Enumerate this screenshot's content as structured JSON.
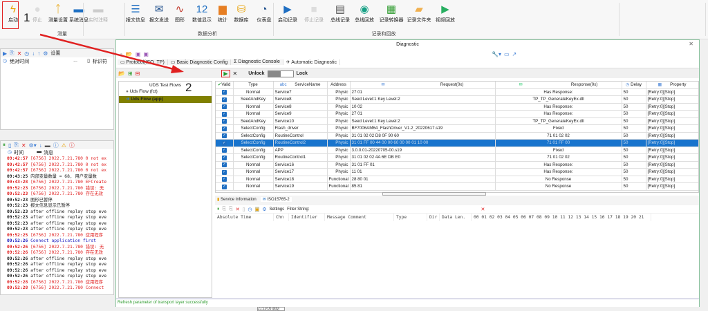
{
  "ribbon": {
    "buttons": [
      {
        "label": "启动",
        "icon": "lightning-icon",
        "disabled": false
      },
      {
        "label": "停止",
        "icon": "stop-circle-icon",
        "disabled": true
      },
      {
        "label": "测量设置",
        "icon": "measurement-setup-icon",
        "disabled": false
      },
      {
        "label": "系统消息",
        "icon": "chat-icon",
        "disabled": false
      },
      {
        "label": "实时注释",
        "icon": "comment-icon",
        "disabled": true
      },
      {
        "label": "报文信息",
        "icon": "list-icon",
        "disabled": false
      },
      {
        "label": "报文发送",
        "icon": "mail-send-icon",
        "disabled": false
      },
      {
        "label": "图形",
        "icon": "line-chart-icon",
        "disabled": false
      },
      {
        "label": "数值显示",
        "icon": "number-icon",
        "disabled": false
      },
      {
        "label": "统计",
        "icon": "bar-chart-icon",
        "disabled": false
      },
      {
        "label": "数据库",
        "icon": "database-icon",
        "disabled": false
      },
      {
        "label": "仪表盘",
        "icon": "gauge-icon",
        "disabled": false
      },
      {
        "label": "启动记录",
        "icon": "play-icon",
        "disabled": false
      },
      {
        "label": "停止记录",
        "icon": "stop-icon",
        "disabled": true
      },
      {
        "label": "总线记录",
        "icon": "bus-record-icon",
        "disabled": false
      },
      {
        "label": "总线回放",
        "icon": "bus-replay-icon",
        "disabled": false
      },
      {
        "label": "记录转换器",
        "icon": "converter-icon",
        "disabled": false
      },
      {
        "label": "记录文件夹",
        "icon": "folder-icon",
        "disabled": false
      },
      {
        "label": "视频回放",
        "icon": "video-play-icon",
        "disabled": false
      }
    ],
    "groups": [
      "测量",
      "数据分析",
      "记录和回放"
    ]
  },
  "annotations": {
    "step1": "1",
    "step2": "2",
    "accent": "#e02020"
  },
  "left_top": {
    "settings_label": "设置",
    "columns": [
      "绝对时间",
      "...",
      "标识符"
    ]
  },
  "left_log": {
    "columns": [
      "时间",
      "消息"
    ],
    "rows": [
      {
        "t": "09:42:57",
        "m": "[6756] 2022.7.21.780 0 not ex",
        "c": "red"
      },
      {
        "t": "09:42:57",
        "m": "[6756] 2022.7.21.780 0 not ex",
        "c": "red"
      },
      {
        "t": "09:42:57",
        "m": "[6756] 2022.7.21.780 0 not ex",
        "c": "red"
      },
      {
        "t": "09:43:25",
        "m": "内部变量数量 = 68, 用户变量数",
        "c": ""
      },
      {
        "t": "09:43:28",
        "m": "[6756] 2022.7.21.780 EFCreate",
        "c": "red"
      },
      {
        "t": "09:52:23",
        "m": "[6756] 2022.7.21.780 错误: 无",
        "c": "red"
      },
      {
        "t": "09:52:23",
        "m": "[6756] 2022.7.21.780 存在无效",
        "c": "red"
      },
      {
        "t": "09:52:23",
        "m": "图形已暂停",
        "c": ""
      },
      {
        "t": "09:52:23",
        "m": "报文信息显示已暂停",
        "c": ""
      },
      {
        "t": "09:52:23",
        "m": "after offline replay stop eve",
        "c": ""
      },
      {
        "t": "09:52:23",
        "m": "after offline replay stop eve",
        "c": ""
      },
      {
        "t": "09:52:23",
        "m": "after offline replay stop eve",
        "c": ""
      },
      {
        "t": "09:52:23",
        "m": "after offline replay stop eve",
        "c": ""
      },
      {
        "t": "09:52:25",
        "m": "[6756] 2022.7.21.780 应用程序",
        "c": "red"
      },
      {
        "t": "09:52:26",
        "m": "Connect application first",
        "c": "blue"
      },
      {
        "t": "09:52:26",
        "m": "[6756] 2022.7.21.780 错误: 无",
        "c": "red"
      },
      {
        "t": "09:52:26",
        "m": "[6756] 2022.7.21.780 存在无效",
        "c": "red"
      },
      {
        "t": "09:52:26",
        "m": "after offline replay stop eve",
        "c": ""
      },
      {
        "t": "09:52:26",
        "m": "after offline replay stop eve",
        "c": ""
      },
      {
        "t": "09:52:26",
        "m": "after offline replay stop eve",
        "c": ""
      },
      {
        "t": "09:52:26",
        "m": "after offline replay stop eve",
        "c": ""
      },
      {
        "t": "09:52:28",
        "m": "[6756] 2022.7.21.780 应用程序",
        "c": "red"
      },
      {
        "t": "09:52:28",
        "m": "[6756] 2022.7.21.780 Connect",
        "c": "red"
      }
    ]
  },
  "diagnostic": {
    "title": "Diagnostic",
    "tabs": [
      "Protocol(ISO_TP)",
      "Basic Diagnostic Config",
      "Diagnostic Console",
      "Automatic Diagnostic"
    ],
    "active_tab": 3,
    "unlock_label": "Unlock",
    "lock_label": "Lock",
    "tree": {
      "header": "UDS Test Flows",
      "items": [
        "Uds Flow (fct)",
        "Uds Flow (app)"
      ],
      "selected": 1
    },
    "grid": {
      "columns": [
        "Valid",
        "Type",
        "ServiceName",
        "Address",
        "Request(0x)",
        "Response(0x)",
        "Delay",
        "Property"
      ],
      "abc": "abc",
      "selected_row": 7,
      "rows": [
        [
          "Normal",
          "Service7",
          "Physic",
          "27 01",
          "Has Response:",
          "50",
          "[Retry:0][Stop]"
        ],
        [
          "SeedAndKey",
          "Service8",
          "Physic",
          "Seed Level:1 Key Level:2",
          "TP_TP_GenerateKeyEx.dll",
          "50",
          "[Retry:0][Stop]"
        ],
        [
          "Normal",
          "Service8",
          "Physic",
          "10 02",
          "Has Response:",
          "50",
          "[Retry:0][Stop]"
        ],
        [
          "Normal",
          "Service9",
          "Physic",
          "27 01",
          "Has Response:",
          "50",
          "[Retry:0][Stop]"
        ],
        [
          "SeedAndKey",
          "Service10",
          "Physic",
          "Seed Level:1 Key Level:2",
          "TP_TP_GenerateKeyEx.dll",
          "50",
          "[Retry:0][Stop]"
        ],
        [
          "SelectConfig",
          "Flash_driver",
          "Physic",
          "BF7006AM64_FlashDriver_V1.2_20220617.s19",
          "Fixed",
          "50",
          "[Retry:0][Stop]"
        ],
        [
          "SelectConfig",
          "RoutineControl",
          "Physic",
          "31 01 02 02 D8 0F 90 60",
          "71 01 02 02",
          "50",
          "[Retry:0][Stop]"
        ],
        [
          "SelectConfig",
          "RoutineControl2",
          "Physic",
          "31 01 FF 00 44 00 00 60 00 00 01 10 00",
          "71 01 FF 00",
          "50",
          "[Retry:0][Stop]"
        ],
        [
          "SelectConfig",
          "APP",
          "Physic",
          "3.0.0.01-20220705-00.s19",
          "Fixed",
          "50",
          "[Retry:0][Stop]"
        ],
        [
          "SelectConfig",
          "RoutineControl1",
          "Physic",
          "31 01 02 02 4A 6E DB E0",
          "71 01 02 02",
          "50",
          "[Retry:0][Stop]"
        ],
        [
          "Normal",
          "Service16",
          "Physic",
          "31 01 FF 01",
          "Has Response:",
          "50",
          "[Retry:0][Stop]"
        ],
        [
          "Normal",
          "Service17",
          "Physic",
          "11 01",
          "Has Response:",
          "50",
          "[Retry:0][Stop]"
        ],
        [
          "Normal",
          "Service18",
          "Functional",
          "28 80 01",
          "No Response",
          "50",
          "[Retry:0][Stop]"
        ],
        [
          "Normal",
          "Service19",
          "Functional",
          "85 81",
          "No Response",
          "50",
          "[Retry:0][Stop]"
        ]
      ]
    },
    "bottom": {
      "tabs": [
        "Service Information",
        "ISO15765-2"
      ],
      "settings_label": "Settings",
      "filter_label": "Filter String:",
      "filter_value": "",
      "columns": [
        "Absolute Time",
        "Chn",
        "Identifier",
        "Message Comment",
        "Type",
        "Dir",
        "Data Len.",
        "00 01 02 03 04 05 06 07 08 09 10 11 12 13 14 15 16 17 18 19 20 21"
      ]
    },
    "status": "Refresh parameter of transport layer successfully",
    "status_color": "#2e9b2e",
    "selection_color": "#1874cd"
  },
  "taskbar_fragment": "21:10:05 启动"
}
